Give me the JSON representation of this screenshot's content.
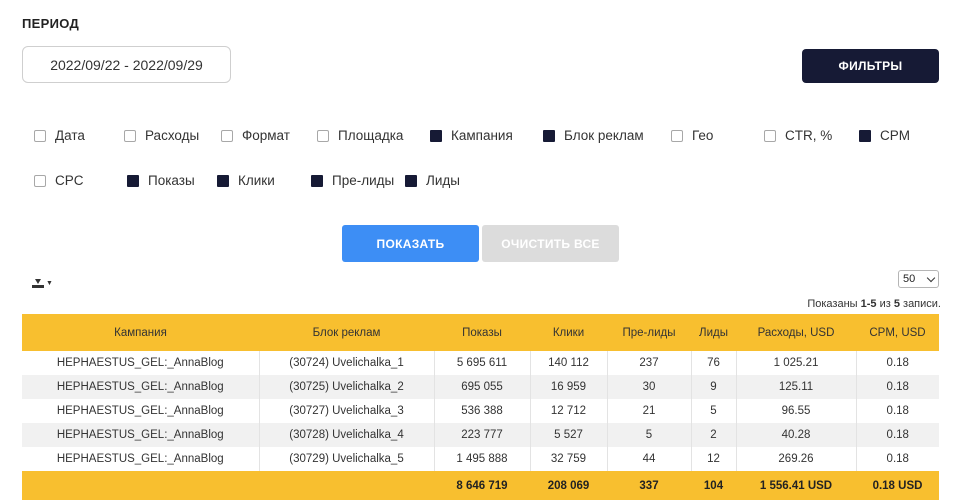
{
  "period": {
    "label": "ПЕРИОД",
    "value": "2022/09/22 - 2022/09/29"
  },
  "filters_button": "ФИЛЬТРЫ",
  "checkbox_rows": [
    [
      {
        "key": "date",
        "label": "Дата",
        "checked": false
      },
      {
        "key": "expenses",
        "label": "Расходы",
        "checked": false
      },
      {
        "key": "format",
        "label": "Формат",
        "checked": false
      },
      {
        "key": "platform",
        "label": "Площадка",
        "checked": false
      },
      {
        "key": "campaign",
        "label": "Кампания",
        "checked": true
      },
      {
        "key": "adblock",
        "label": "Блок реклам",
        "checked": true
      },
      {
        "key": "geo",
        "label": "Гео",
        "checked": false
      },
      {
        "key": "ctr",
        "label": "CTR, %",
        "checked": false
      },
      {
        "key": "cpm",
        "label": "CPM",
        "checked": true
      }
    ],
    [
      {
        "key": "cpc",
        "label": "CPC",
        "checked": false
      },
      {
        "key": "impressions",
        "label": "Показы",
        "checked": true
      },
      {
        "key": "clicks",
        "label": "Клики",
        "checked": true
      },
      {
        "key": "prelids",
        "label": "Пре-лиды",
        "checked": true
      },
      {
        "key": "leads",
        "label": "Лиды",
        "checked": true
      }
    ]
  ],
  "actions": {
    "show": "ПОКАЗАТЬ",
    "clear": "ОЧИСТИТЬ ВСЕ"
  },
  "page_size": "50",
  "summary": {
    "prefix": "Показаны ",
    "range": "1-5",
    "middle": " из ",
    "total": "5",
    "suffix": " записи."
  },
  "table": {
    "headers": [
      "Кампания",
      "Блок реклам",
      "Показы",
      "Клики",
      "Пре-лиды",
      "Лиды",
      "Расходы, USD",
      "CPM, USD"
    ],
    "rows": [
      [
        "HEPHAESTUS_GEL:_AnnaBlog",
        "(30724) Uvelichalka_1",
        "5 695 611",
        "140 112",
        "237",
        "76",
        "1 025.21",
        "0.18"
      ],
      [
        "HEPHAESTUS_GEL:_AnnaBlog",
        "(30725) Uvelichalka_2",
        "695 055",
        "16 959",
        "30",
        "9",
        "125.11",
        "0.18"
      ],
      [
        "HEPHAESTUS_GEL:_AnnaBlog",
        "(30727) Uvelichalka_3",
        "536 388",
        "12 712",
        "21",
        "5",
        "96.55",
        "0.18"
      ],
      [
        "HEPHAESTUS_GEL:_AnnaBlog",
        "(30728) Uvelichalka_4",
        "223 777",
        "5 527",
        "5",
        "2",
        "40.28",
        "0.18"
      ],
      [
        "HEPHAESTUS_GEL:_AnnaBlog",
        "(30729) Uvelichalka_5",
        "1 495 888",
        "32 759",
        "44",
        "12",
        "269.26",
        "0.18"
      ]
    ],
    "totals": [
      "",
      "",
      "8 646 719",
      "208 069",
      "337",
      "104",
      "1 556.41 USD",
      "0.18 USD"
    ]
  },
  "icons": {
    "export": "download-icon",
    "caret": "caret-down-icon"
  }
}
